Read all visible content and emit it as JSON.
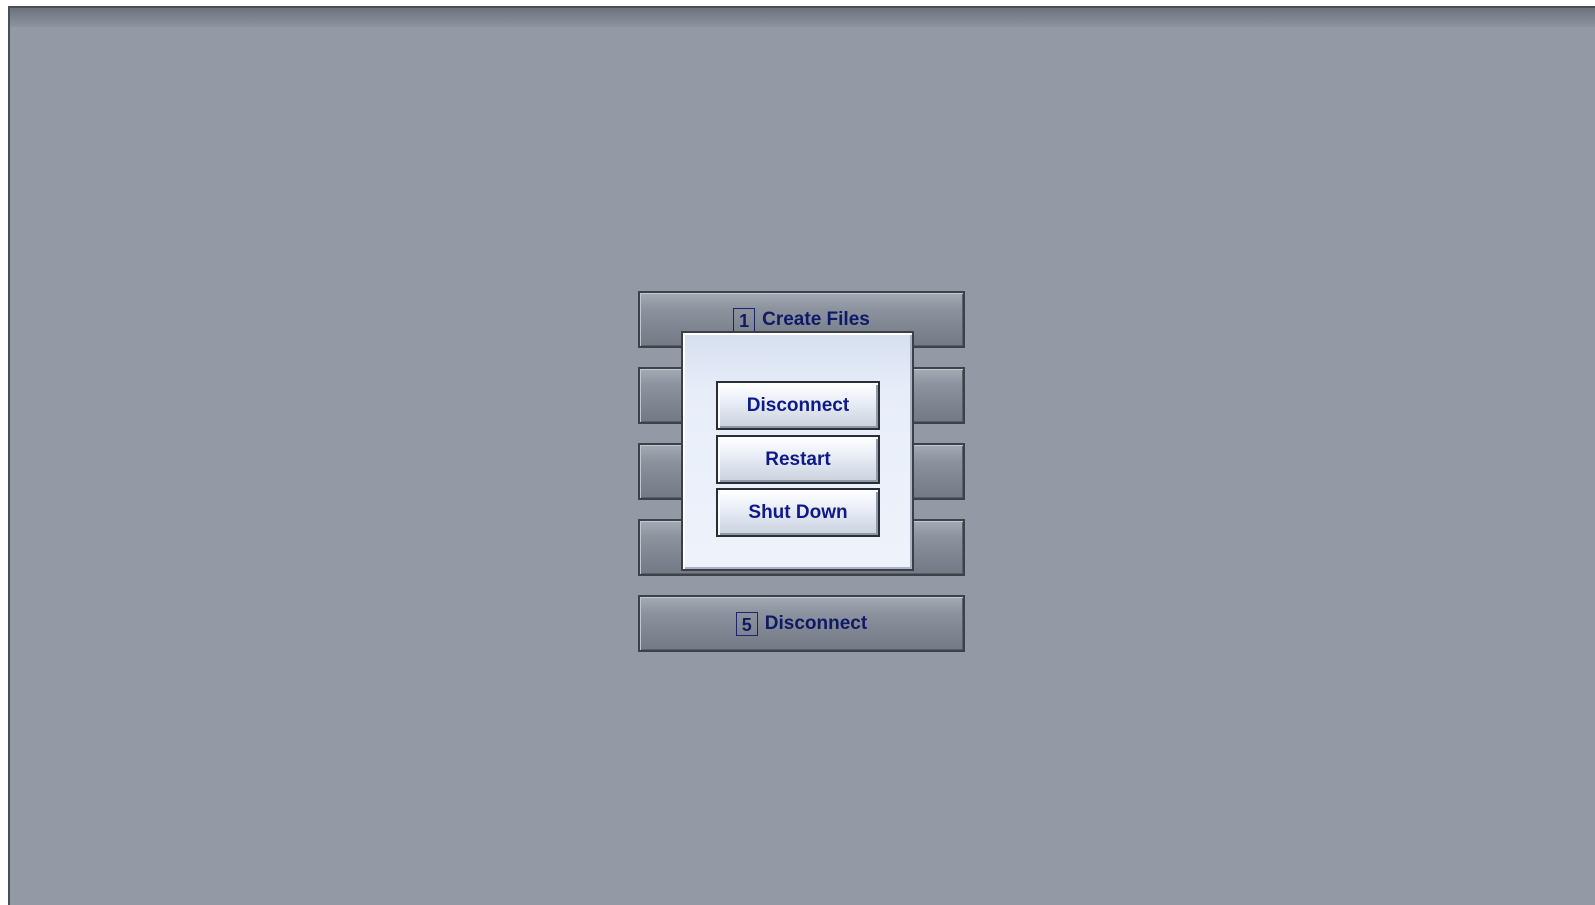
{
  "menu": {
    "items": [
      {
        "number": "1",
        "label": "Create Files"
      },
      {
        "number": "",
        "label": ""
      },
      {
        "number": "",
        "label": ""
      },
      {
        "number": "",
        "label": ""
      },
      {
        "number": "5",
        "label": "Disconnect"
      }
    ]
  },
  "dialog": {
    "buttons": [
      {
        "label": "Disconnect"
      },
      {
        "label": "Restart"
      },
      {
        "label": "Shut Down"
      }
    ]
  },
  "colors": {
    "background": "#939aa5",
    "button_text": "#0f1a88",
    "dialog_background": "#eef2fb"
  }
}
